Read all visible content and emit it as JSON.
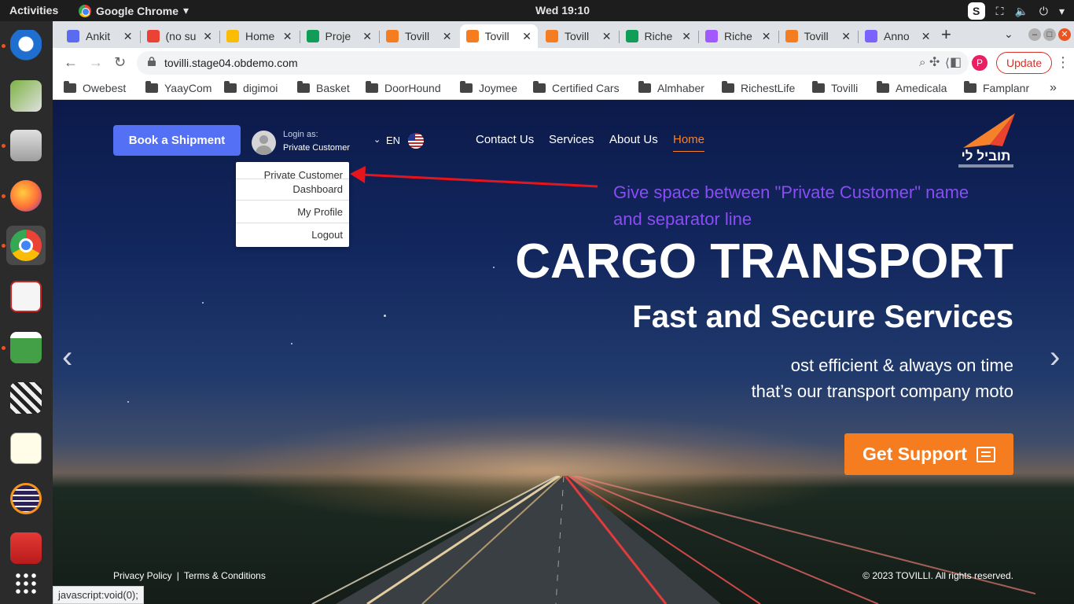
{
  "system": {
    "activities": "Activities",
    "app_name": "Google Chrome",
    "clock": "Wed 19:10",
    "tray_badge": "S"
  },
  "dock": {
    "items": [
      "thunderbird-icon",
      "image-viewer-icon",
      "file-cabinet-icon",
      "firefox-icon",
      "chrome-icon",
      "document-viewer-icon",
      "spreadsheet-icon",
      "video-editor-icon",
      "text-editor-icon",
      "eclipse-icon",
      "app-icon",
      "show-apps-icon"
    ]
  },
  "tabs": [
    {
      "title": "Ankit",
      "favicon_color": "#5b6bf0"
    },
    {
      "title": "(no su",
      "favicon_color": "#ea4335"
    },
    {
      "title": "Home",
      "favicon_color": "#fbbc04"
    },
    {
      "title": "Proje",
      "favicon_color": "#0f9d58"
    },
    {
      "title": "Tovill",
      "favicon_color": "#f57c1f"
    },
    {
      "title": "Tovill",
      "favicon_color": "#f57c1f",
      "active": true
    },
    {
      "title": "Tovill",
      "favicon_color": "#f57c1f"
    },
    {
      "title": "Riche",
      "favicon_color": "#0f9d58"
    },
    {
      "title": "Riche",
      "favicon_color": "#a259ff"
    },
    {
      "title": "Tovill",
      "favicon_color": "#f57c1f"
    },
    {
      "title": "Anno",
      "favicon_color": "#7b61ff"
    }
  ],
  "toolbar": {
    "url": "tovilli.stage04.obdemo.com",
    "profile_initial": "P",
    "update_label": "Update"
  },
  "bookmarks": [
    "Owebest",
    "YaayCom",
    "digimoi",
    "Basket",
    "DoorHound",
    "Joymee",
    "Certified Cars",
    "Almhaber",
    "RichestLife",
    "Tovilli",
    "Amedicala",
    "Famplanr"
  ],
  "site": {
    "book_button": "Book a Shipment",
    "login_as": "Login as:",
    "user_name": "Private Customer",
    "lang": "EN",
    "nav": [
      "Contact Us",
      "Services",
      "About Us",
      "Home"
    ],
    "logo_text": "תוביל לי",
    "dropdown": {
      "name": "Private Customer",
      "items": [
        "Dashboard",
        "My Profile",
        "Logout"
      ]
    },
    "annotation_l1": "Give space between \"Private Customer\" name",
    "annotation_l2": "and separator line",
    "hero_title": "CARGO TRANSPORT",
    "hero_subtitle": "Fast and Secure Services",
    "hero_line1": "ost efficient & always on time",
    "hero_line2": "that’s our transport company moto",
    "support_button": "Get Support",
    "footer_privacy": "Privacy Policy",
    "footer_sep": "|",
    "footer_terms": "Terms & Conditions",
    "copyright": "© 2023 TOVILLI. All rights reserved."
  },
  "status_url": "javascript:void(0);",
  "colors": {
    "accent_orange": "#f5822a",
    "book_blue": "#5470f5",
    "annotation_purple": "#8b4cf6",
    "arrow_red": "#e8141c"
  }
}
